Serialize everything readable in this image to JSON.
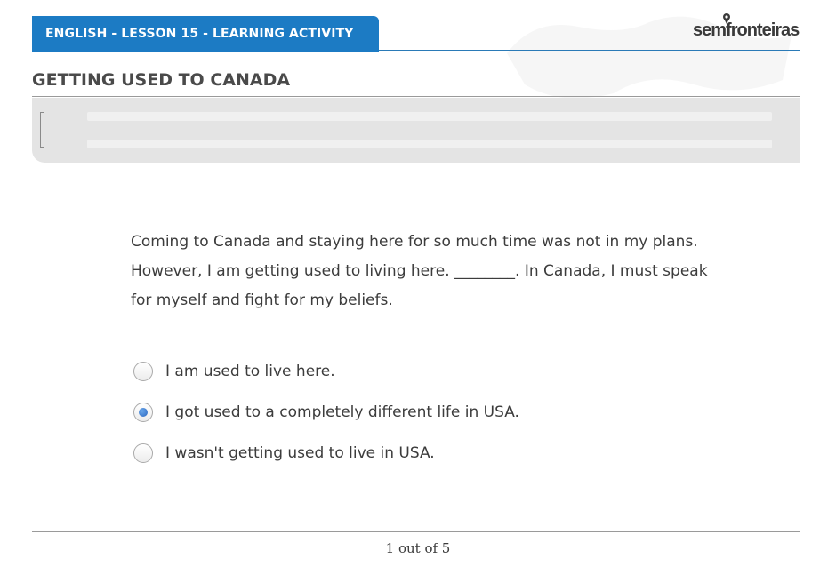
{
  "header": {
    "lesson_tab": "ENGLISH - LESSON 15 - LEARNING ACTIVITY",
    "logo_text": "semfronteiras",
    "accent_color": "#1c7bc4"
  },
  "page_title": "GETTING USED TO CANADA",
  "question": {
    "text": "Coming to Canada and staying here for so much time was not in my plans. However, I am getting used to living here. ________. In Canada, I must speak for myself and fight for my beliefs."
  },
  "options": [
    {
      "label": "I am used to live here.",
      "selected": false
    },
    {
      "label": "I got used to a completely different life in USA.",
      "selected": true
    },
    {
      "label": "I wasn't getting used to live in USA.",
      "selected": false
    }
  ],
  "pager": {
    "text": "1 out of 5"
  }
}
